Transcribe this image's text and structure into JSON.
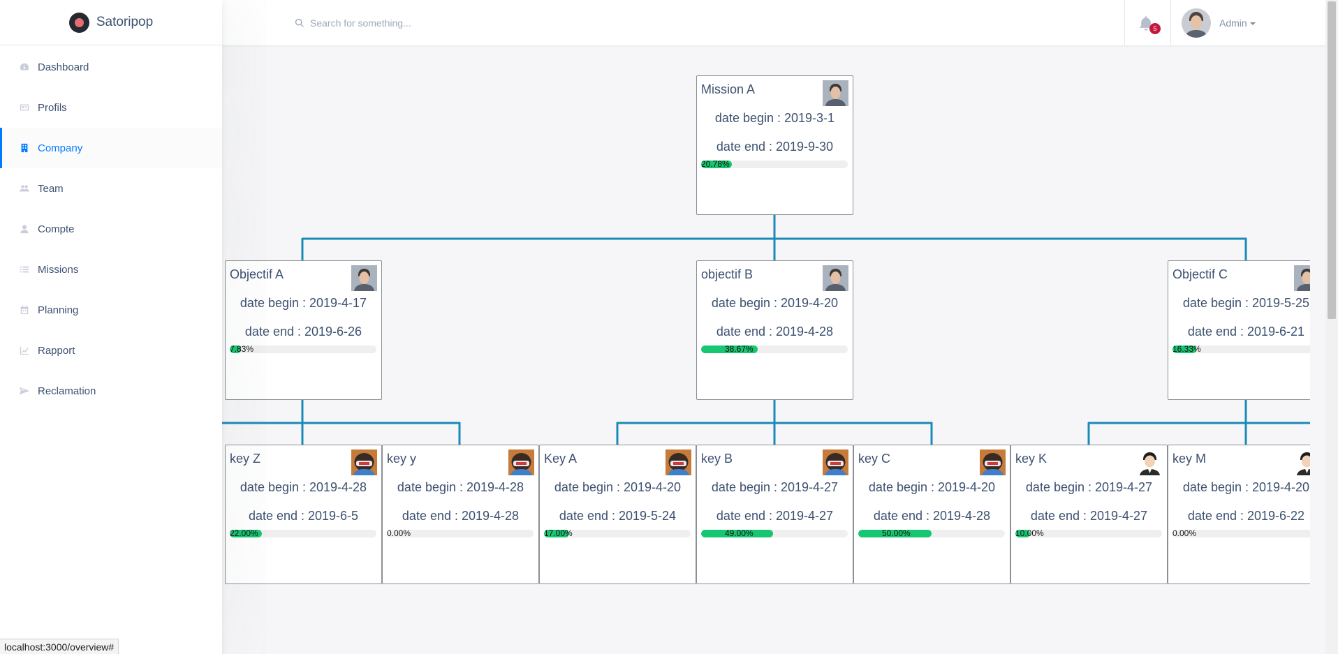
{
  "brand": {
    "name": "Satoripop"
  },
  "sidebar": {
    "items": [
      {
        "label": "Dashboard",
        "icon": "dashboard-icon"
      },
      {
        "label": "Profils",
        "icon": "id-card-icon"
      },
      {
        "label": "Company",
        "icon": "building-icon",
        "active": true
      },
      {
        "label": "Team",
        "icon": "people-icon"
      },
      {
        "label": "Compte",
        "icon": "person-icon"
      },
      {
        "label": "Missions",
        "icon": "list-icon"
      },
      {
        "label": "Planning",
        "icon": "calendar-icon"
      },
      {
        "label": "Rapport",
        "icon": "chart-icon"
      },
      {
        "label": "Reclamation",
        "icon": "send-icon"
      }
    ]
  },
  "header": {
    "search_placeholder": "Search for something...",
    "notifications_count": "5",
    "user_name": "Admin"
  },
  "colors": {
    "accent": "#007bff",
    "connector": "#1a8ab8",
    "progress": "#17c671",
    "badge": "#c4183c"
  },
  "org": {
    "mission": {
      "title": "Mission A",
      "begin": "date begin : 2019-3-1",
      "end": "date end : 2019-9-30",
      "progress_label": "20.78%",
      "progress": 0.2078,
      "avatar": "man-avatar-icon"
    },
    "objectives": [
      {
        "title": "Objectif A",
        "begin": "date begin : 2019-4-17",
        "end": "date end : 2019-6-26",
        "progress_label": "7.83%",
        "progress": 0.0783,
        "avatar": "man-avatar-icon"
      },
      {
        "title": "objectif B",
        "begin": "date begin : 2019-4-20",
        "end": "date end : 2019-4-28",
        "progress_label": "38.67%",
        "progress": 0.3867,
        "avatar": "man-avatar-icon"
      },
      {
        "title": "Objectif C",
        "begin": "date begin : 2019-5-25",
        "end": "date end : 2019-6-21",
        "progress_label": "16.33%",
        "progress": 0.1633,
        "avatar": "man-avatar-icon"
      }
    ],
    "keys": [
      {
        "title": "key Z",
        "begin": "date begin : 2019-4-28",
        "end": "date end : 2019-6-5",
        "progress_label": "22.00%",
        "progress": 0.22,
        "avatar": "astronaut-avatar-icon"
      },
      {
        "title": "key y",
        "begin": "date begin : 2019-4-28",
        "end": "date end : 2019-4-28",
        "progress_label": "0.00%",
        "progress": 0,
        "avatar": "astronaut-avatar-icon"
      },
      {
        "title": "Key A",
        "begin": "date begin : 2019-4-20",
        "end": "date end : 2019-5-24",
        "progress_label": "17.00%",
        "progress": 0.17,
        "avatar": "astronaut-avatar-icon"
      },
      {
        "title": "key B",
        "begin": "date begin : 2019-4-27",
        "end": "date end : 2019-4-27",
        "progress_label": "49.00%",
        "progress": 0.49,
        "avatar": "astronaut-avatar-icon"
      },
      {
        "title": "key C",
        "begin": "date begin : 2019-4-20",
        "end": "date end : 2019-4-28",
        "progress_label": "50.00%",
        "progress": 0.5,
        "avatar": "astronaut-avatar-icon"
      },
      {
        "title": "key K",
        "begin": "date begin : 2019-4-27",
        "end": "date end : 2019-4-27",
        "progress_label": "10.00%",
        "progress": 0.1,
        "avatar": "cartoon-man-avatar-icon"
      },
      {
        "title": "key M",
        "begin": "date begin : 2019-4-20",
        "end": "date end : 2019-6-22",
        "progress_label": "0.00%",
        "progress": 0,
        "avatar": "cartoon-man-avatar-icon"
      }
    ]
  },
  "statusbar": {
    "url": "localhost:3000/overview#"
  }
}
